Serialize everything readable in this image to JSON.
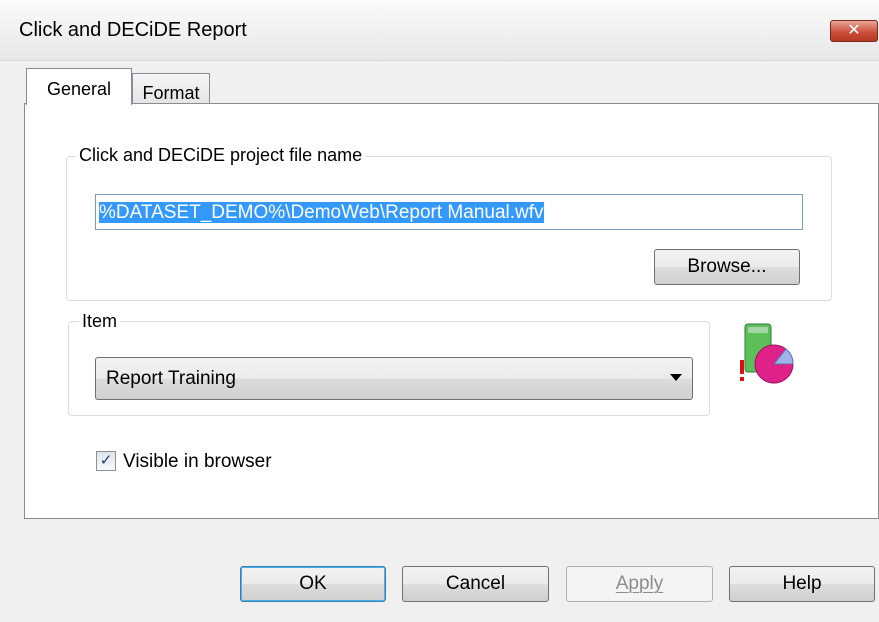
{
  "window": {
    "title": "Click and DECiDE Report",
    "close_glyph": "✕"
  },
  "tabs": [
    {
      "label": "General",
      "active": true
    },
    {
      "label": "Format",
      "active": false
    }
  ],
  "file_group": {
    "legend": "Click and DECiDE project file name",
    "file_value": "%DATASET_DEMO%\\DemoWeb\\Report Manual.wfv",
    "browse_label": "Browse..."
  },
  "item_group": {
    "legend": "Item",
    "selected": "Report Training",
    "icon": "report-chart-icon"
  },
  "visible_checkbox": {
    "label": "Visible in browser",
    "checked": true,
    "glyph": "✓"
  },
  "footer": {
    "ok_label": "OK",
    "cancel_label": "Cancel",
    "apply_label": "Apply",
    "help_label": "Help"
  },
  "colors": {
    "selection": "#3399ff",
    "close_button": "#c94a36",
    "group_border": "#d5dfe5"
  }
}
